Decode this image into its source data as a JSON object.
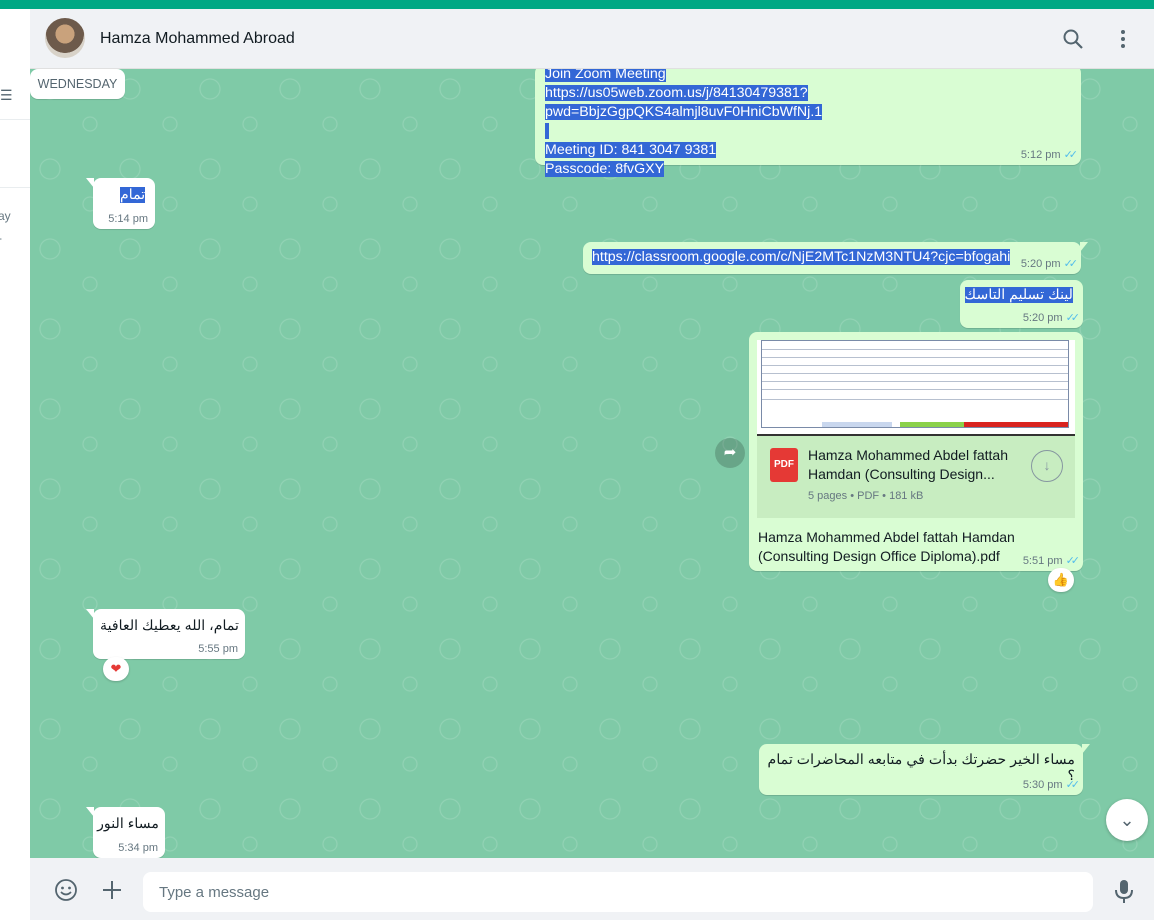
{
  "header": {
    "contact_name": "Hamza Mohammed Abroad"
  },
  "left_fragments": {
    "line1": "ay",
    "line2": "-"
  },
  "messages": {
    "zoom": {
      "lines": [
        "Join Zoom Meeting",
        "https://us05web.zoom.us/j/84130479381?pwd=BbjzGgpQKS4almjl8uvF0HniCbWfNj.1",
        "",
        "Meeting ID: 841 3047 9381",
        "Passcode: 8fvGXY"
      ],
      "time": "5:12 pm"
    },
    "tamam": {
      "text": "تمام",
      "time": "5:14 pm"
    },
    "link": {
      "text": "https://classroom.google.com/c/NjE2MTc1NzM3NTU4?cjc=bfogahi",
      "time": "5:20 pm"
    },
    "task": {
      "text": "لينك تسليم التاسك",
      "time": "5:20 pm"
    },
    "doc": {
      "file_name_preview": "Hamza Mohammed Abdel fattah Hamdan (Consulting Design...",
      "file_meta": "5 pages • PDF • 181 kB",
      "pdf_label": "PDF",
      "caption": "Hamza Mohammed Abdel fattah Hamdan (Consulting Design Office Diploma).pdf",
      "time": "5:51 pm",
      "reaction": "👍"
    },
    "tamam2": {
      "text": "تمام، الله يعطيك العافية",
      "time": "5:55 pm",
      "reaction": "❤"
    },
    "day_separator": "WEDNESDAY",
    "evening": {
      "text": "مساء الخير حضرتك بدأت في متابعه المحاضرات تمام ؟",
      "time": "5:30 pm"
    },
    "noor": {
      "text": "مساء النور",
      "time": "5:34 pm"
    }
  },
  "composer": {
    "placeholder": "Type a message"
  },
  "icons": {
    "search": "search-icon",
    "menu": "vertical-dots-icon",
    "emoji": "emoji-icon",
    "attach": "plus-icon",
    "mic": "microphone-icon",
    "forward": "forward-icon",
    "download": "download-icon",
    "scroll": "chevron-down-icon",
    "filter": "filter-icon"
  },
  "colors": {
    "accent": "#00a884",
    "chat_bg": "#7fcaa7",
    "outgoing": "#d9fdd3",
    "incoming": "#ffffff",
    "read_tick": "#53bdeb",
    "selection": "#3367d6"
  }
}
